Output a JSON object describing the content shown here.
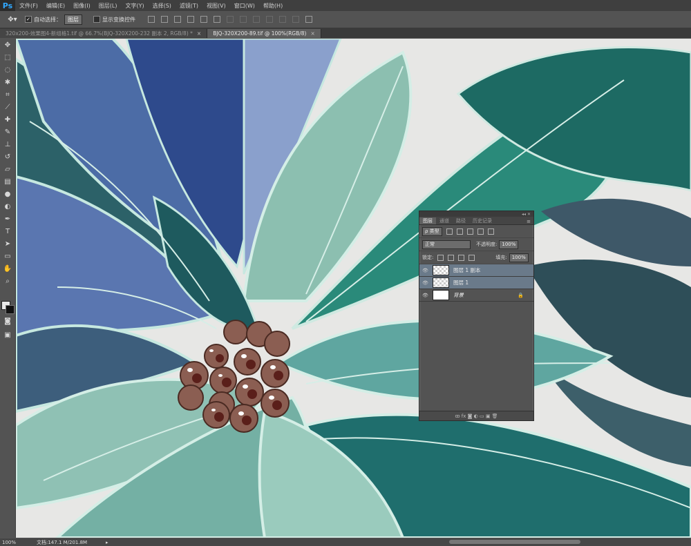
{
  "app": {
    "logo": "Ps"
  },
  "menu": [
    "文件(F)",
    "编辑(E)",
    "图像(I)",
    "图层(L)",
    "文字(Y)",
    "选择(S)",
    "滤镜(T)",
    "视图(V)",
    "窗口(W)",
    "帮助(H)"
  ],
  "options": {
    "auto_select_label": "自动选择：",
    "auto_select_value": "图层",
    "show_transform_label": "显示变换控件"
  },
  "tabs": [
    {
      "label": "320x200-效果图4-新组格1.tif @ 66.7%(BJQ-320X200-232 副本 2, RGB/8) *",
      "close": "×"
    },
    {
      "label": "BJQ-320X200-89.tif @ 100%(RGB/8)",
      "close": "×"
    }
  ],
  "status": {
    "zoom": "100%",
    "doc": "文档:147.1 M/201.8M",
    "arrow": "▸"
  },
  "layers_panel": {
    "top_controls": "◂◂ ✕",
    "tabs": [
      "图层",
      "通道",
      "路径",
      "历史记录"
    ],
    "menu_icon": "≡",
    "filter_label": "ρ 类型",
    "blend_mode": "正常",
    "opacity_label": "不透明度:",
    "opacity_value": "100%",
    "lock_label": "锁定:",
    "fill_label": "填充:",
    "fill_value": "100%",
    "layers": [
      {
        "name": "图层 1 副本",
        "eye": "👁"
      },
      {
        "name": "图层 1",
        "eye": "👁"
      },
      {
        "name": "背景",
        "eye": "👁",
        "lock": "🔒"
      }
    ],
    "footer_icons": "ꝏ fx ◙ ◐ ▭ ▣ 🗑"
  }
}
